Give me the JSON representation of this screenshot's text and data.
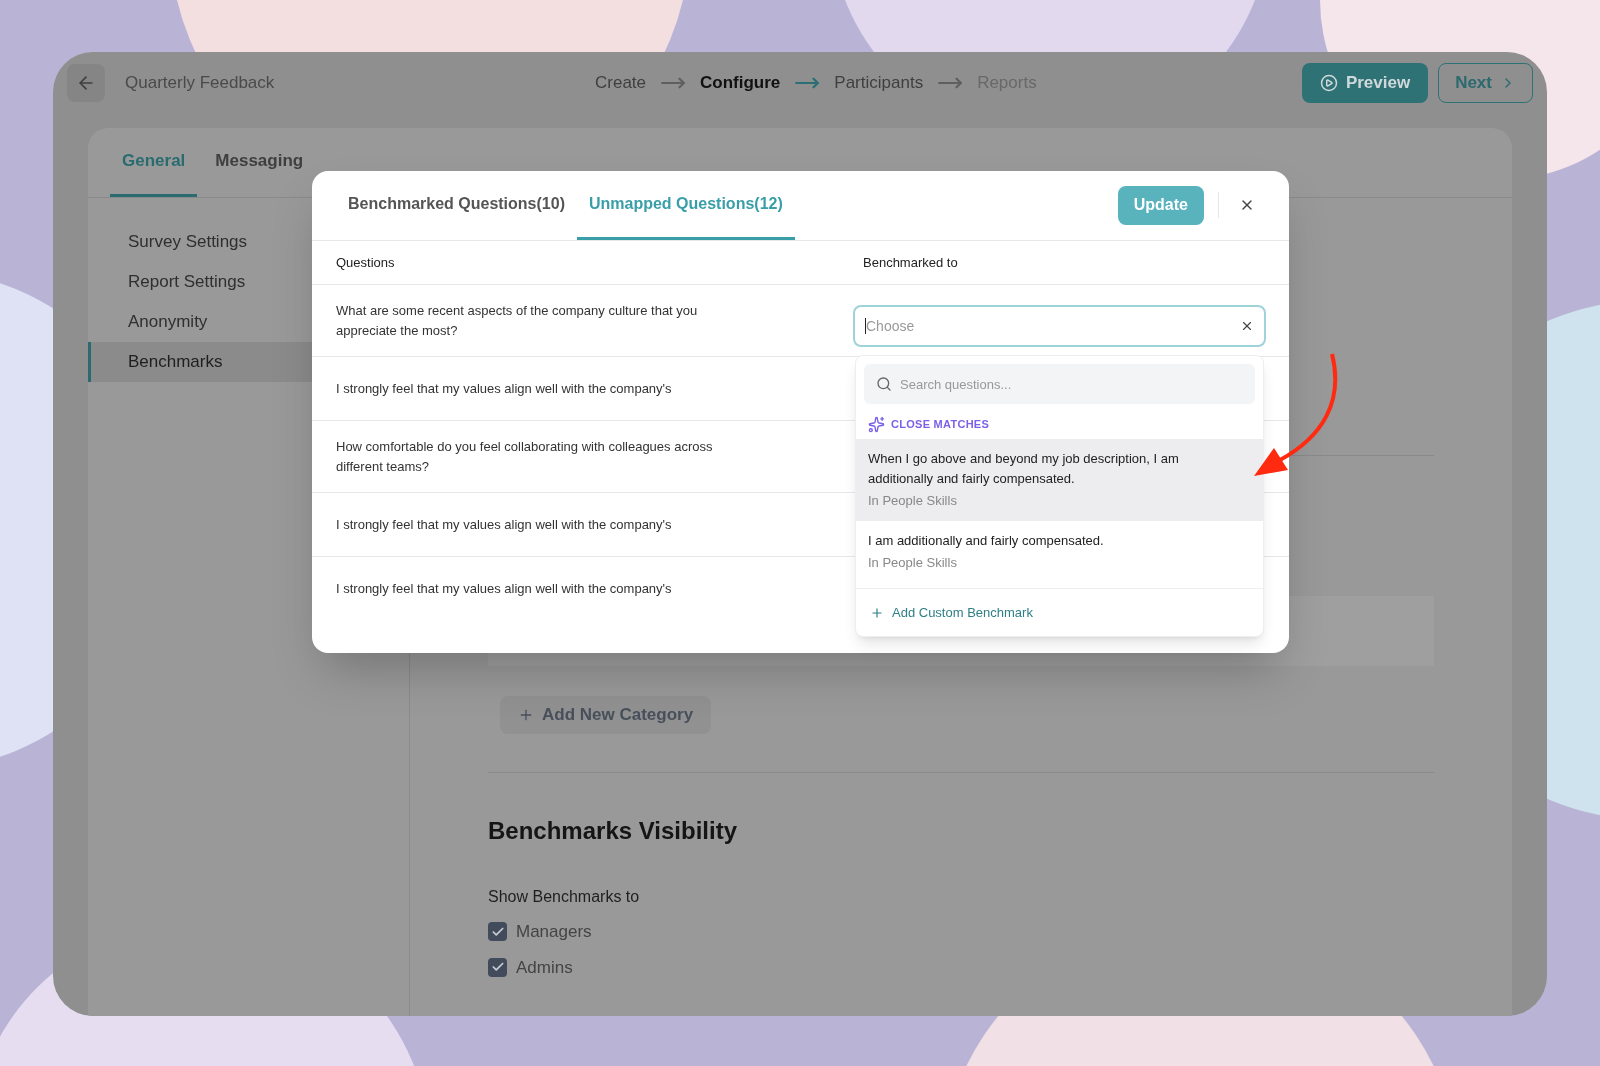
{
  "app_bar": {
    "title": "Quarterly Feedback",
    "steps": [
      {
        "label": "Create",
        "selected": false,
        "disabled": false
      },
      {
        "label": "Configure",
        "selected": true,
        "disabled": false
      },
      {
        "label": "Participants",
        "selected": false,
        "disabled": false
      },
      {
        "label": "Reports",
        "selected": false,
        "disabled": true
      }
    ],
    "preview_button": "Preview",
    "next_button": "Next"
  },
  "tabs": [
    {
      "label": "General",
      "selected": true
    },
    {
      "label": "Messaging",
      "selected": false
    }
  ],
  "sidebar": {
    "items": [
      {
        "label": "Survey Settings",
        "selected": false
      },
      {
        "label": "Report Settings",
        "selected": false
      },
      {
        "label": "Anonymity",
        "selected": false
      },
      {
        "label": "Benchmarks",
        "selected": true
      }
    ]
  },
  "main": {
    "add_category_button": "Add New Category",
    "visibility": {
      "title": "Benchmarks Visibility",
      "label": "Show Benchmarks to",
      "options": [
        {
          "label": "Managers",
          "checked": true
        },
        {
          "label": "Admins",
          "checked": true
        }
      ]
    }
  },
  "modal": {
    "tabs": [
      {
        "label": "Benchmarked Questions(10)",
        "selected": false
      },
      {
        "label": "Unmapped Questions(12)",
        "selected": true
      }
    ],
    "update_button": "Update",
    "columns": [
      "Questions",
      "Benchmarked to"
    ],
    "rows": [
      {
        "question": "What are some recent aspects of the company culture that you appreciate the most?"
      },
      {
        "question": "I strongly feel that my values align well with the company's"
      },
      {
        "question": "How comfortable do you feel collaborating with colleagues across different teams?"
      },
      {
        "question": "I strongly feel that my values align well with the company's"
      },
      {
        "question": "I strongly feel that my values align well with the company's"
      }
    ],
    "select": {
      "placeholder": "Choose"
    },
    "dropdown": {
      "search_placeholder": "Search questions...",
      "section": "CLOSE MATCHES",
      "options": [
        {
          "text": "When I go above and beyond my job description, I am additionally and fairly compensated.",
          "category": "In People Skills",
          "highlighted": true
        },
        {
          "text": "I am additionally and fairly compensated.",
          "category": "In People Skills",
          "highlighted": false
        }
      ],
      "add_link": "Add Custom Benchmark"
    }
  }
}
